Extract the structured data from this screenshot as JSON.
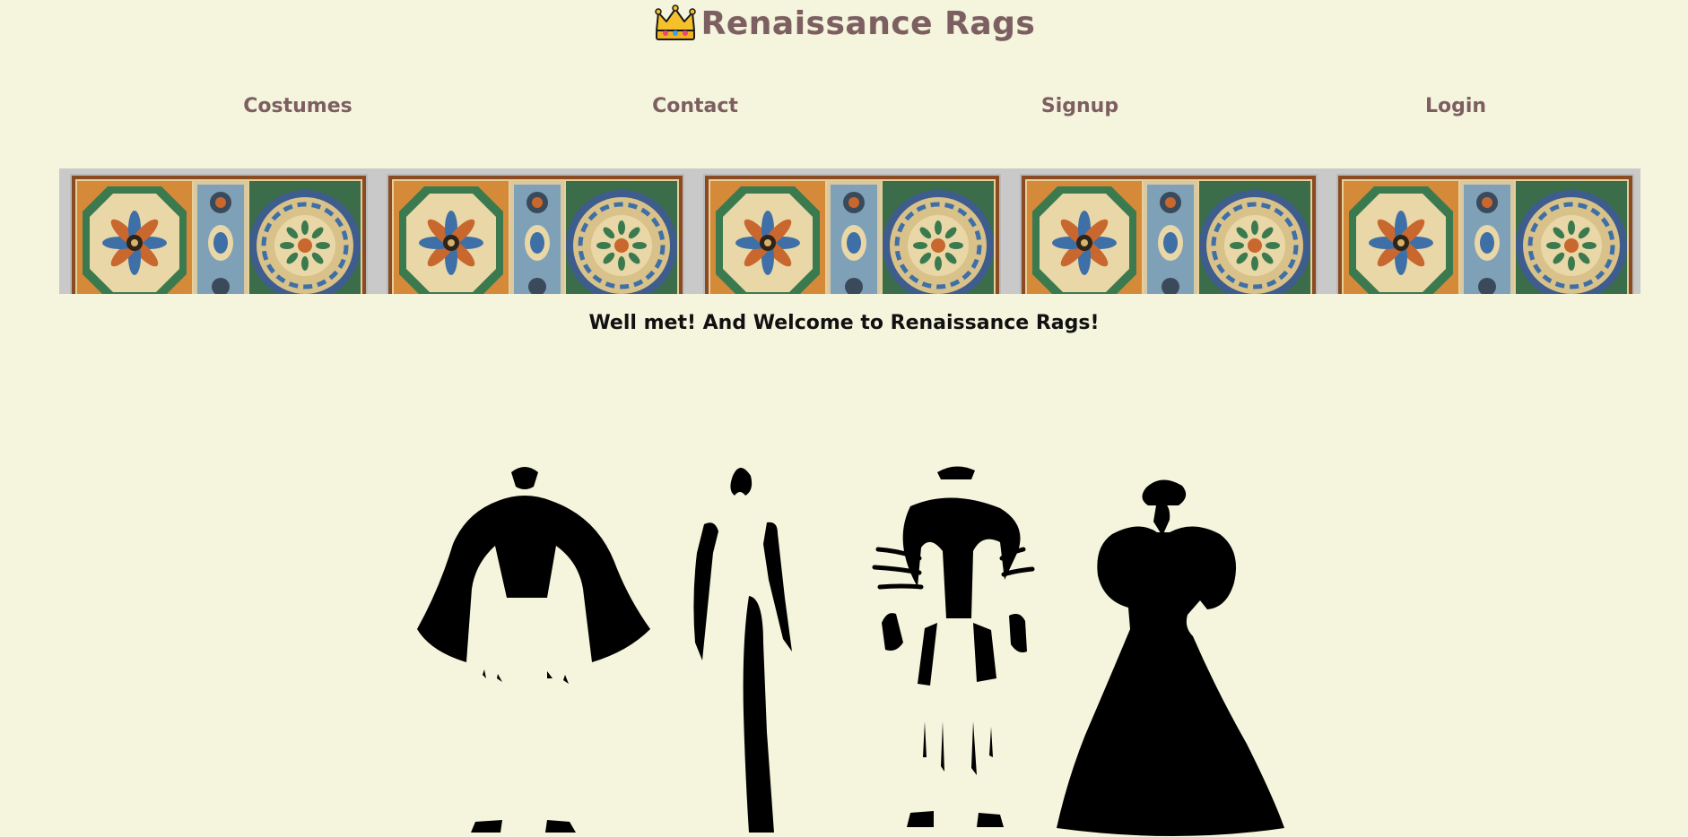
{
  "header": {
    "title": "Renaissance Rags",
    "logo_icon": "crown-icon"
  },
  "nav": {
    "costumes": "Costumes",
    "contact": "Contact",
    "signup": "Signup",
    "login": "Login"
  },
  "banner": {
    "tile_count": 5,
    "pattern": "ornate-tile"
  },
  "main": {
    "welcome": "Well met! And Welcome to Renaissance Rags!"
  },
  "colors": {
    "background": "#f5f4dc",
    "brand": "#7d5f62",
    "text": "#111111"
  }
}
